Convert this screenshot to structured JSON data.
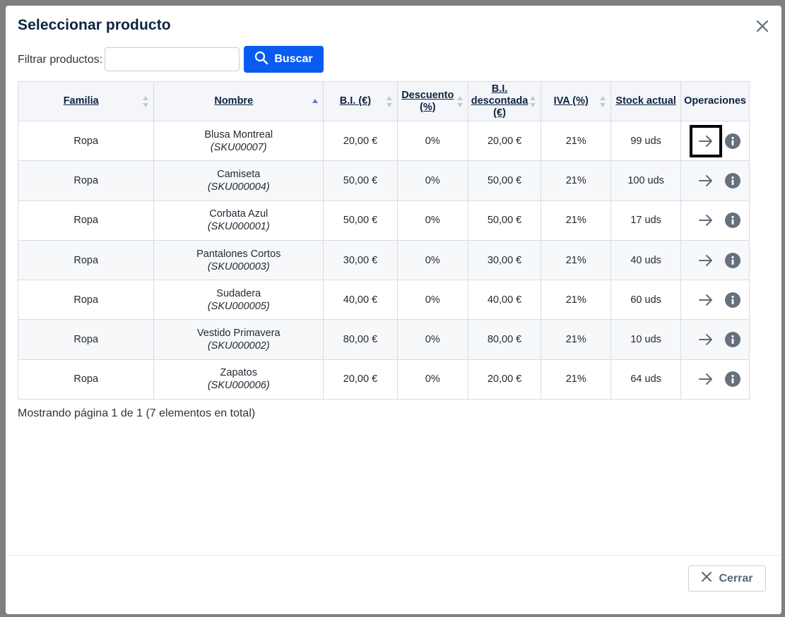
{
  "modal": {
    "title": "Seleccionar producto",
    "filter_label": "Filtrar productos:",
    "filter_value": "",
    "filter_placeholder": "",
    "search_label": "Buscar",
    "close_label": "Cerrar"
  },
  "table": {
    "headers": {
      "familia": "Familia",
      "nombre": "Nombre",
      "bi": "B.I. (€)",
      "descuento": "Descuento (%)",
      "bi_descontada": "B.I. descontada (€)",
      "iva": "IVA (%)",
      "stock": "Stock actual",
      "operaciones": "Operaciones"
    },
    "sorted_column": "nombre",
    "sort_direction": "asc",
    "rows": [
      {
        "familia": "Ropa",
        "nombre": "Blusa Montreal",
        "sku": "(SKU00007)",
        "bi": "20,00 €",
        "descuento": "0%",
        "bi_descontada": "20,00 €",
        "iva": "21%",
        "stock": "99 uds"
      },
      {
        "familia": "Ropa",
        "nombre": "Camiseta",
        "sku": "(SKU000004)",
        "bi": "50,00 €",
        "descuento": "0%",
        "bi_descontada": "50,00 €",
        "iva": "21%",
        "stock": "100 uds"
      },
      {
        "familia": "Ropa",
        "nombre": "Corbata Azul",
        "sku": "(SKU000001)",
        "bi": "50,00 €",
        "descuento": "0%",
        "bi_descontada": "50,00 €",
        "iva": "21%",
        "stock": "17 uds"
      },
      {
        "familia": "Ropa",
        "nombre": "Pantalones Cortos",
        "sku": "(SKU000003)",
        "bi": "30,00 €",
        "descuento": "0%",
        "bi_descontada": "30,00 €",
        "iva": "21%",
        "stock": "40 uds"
      },
      {
        "familia": "Ropa",
        "nombre": "Sudadera",
        "sku": "(SKU000005)",
        "bi": "40,00 €",
        "descuento": "0%",
        "bi_descontada": "40,00 €",
        "iva": "21%",
        "stock": "60 uds"
      },
      {
        "familia": "Ropa",
        "nombre": "Vestido Primavera",
        "sku": "(SKU000002)",
        "bi": "80,00 €",
        "descuento": "0%",
        "bi_descontada": "80,00 €",
        "iva": "21%",
        "stock": "10 uds"
      },
      {
        "familia": "Ropa",
        "nombre": "Zapatos",
        "sku": "(SKU000006)",
        "bi": "20,00 €",
        "descuento": "0%",
        "bi_descontada": "20,00 €",
        "iva": "21%",
        "stock": "64 uds"
      }
    ],
    "row_icons": [
      "arrow-right-icon",
      "info-icon"
    ],
    "focused_row": 0
  },
  "pagination": {
    "text": "Mostrando página 1 de 1 (7 elementos en total)"
  },
  "colors": {
    "primary": "#0a5cf0",
    "title": "#0e2340",
    "sort_active": "#6477d9"
  }
}
